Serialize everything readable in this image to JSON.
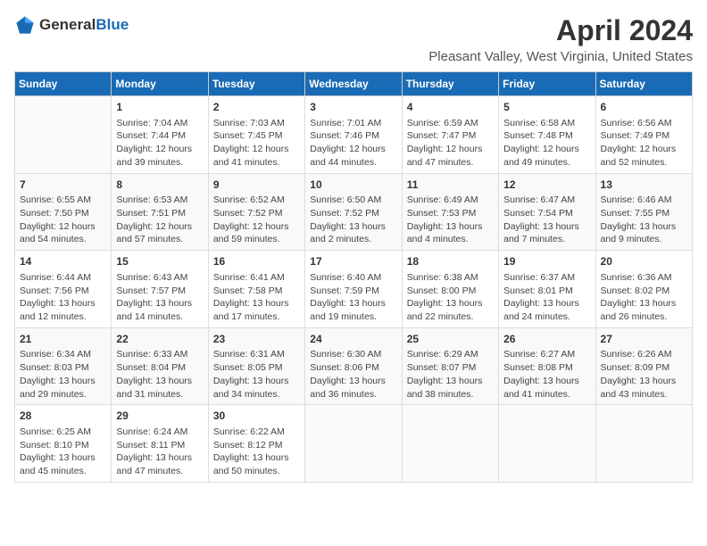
{
  "logo": {
    "general": "General",
    "blue": "Blue"
  },
  "title": "April 2024",
  "subtitle": "Pleasant Valley, West Virginia, United States",
  "days_of_week": [
    "Sunday",
    "Monday",
    "Tuesday",
    "Wednesday",
    "Thursday",
    "Friday",
    "Saturday"
  ],
  "weeks": [
    [
      {
        "day": "",
        "content": ""
      },
      {
        "day": "1",
        "content": "Sunrise: 7:04 AM\nSunset: 7:44 PM\nDaylight: 12 hours\nand 39 minutes."
      },
      {
        "day": "2",
        "content": "Sunrise: 7:03 AM\nSunset: 7:45 PM\nDaylight: 12 hours\nand 41 minutes."
      },
      {
        "day": "3",
        "content": "Sunrise: 7:01 AM\nSunset: 7:46 PM\nDaylight: 12 hours\nand 44 minutes."
      },
      {
        "day": "4",
        "content": "Sunrise: 6:59 AM\nSunset: 7:47 PM\nDaylight: 12 hours\nand 47 minutes."
      },
      {
        "day": "5",
        "content": "Sunrise: 6:58 AM\nSunset: 7:48 PM\nDaylight: 12 hours\nand 49 minutes."
      },
      {
        "day": "6",
        "content": "Sunrise: 6:56 AM\nSunset: 7:49 PM\nDaylight: 12 hours\nand 52 minutes."
      }
    ],
    [
      {
        "day": "7",
        "content": "Sunrise: 6:55 AM\nSunset: 7:50 PM\nDaylight: 12 hours\nand 54 minutes."
      },
      {
        "day": "8",
        "content": "Sunrise: 6:53 AM\nSunset: 7:51 PM\nDaylight: 12 hours\nand 57 minutes."
      },
      {
        "day": "9",
        "content": "Sunrise: 6:52 AM\nSunset: 7:52 PM\nDaylight: 12 hours\nand 59 minutes."
      },
      {
        "day": "10",
        "content": "Sunrise: 6:50 AM\nSunset: 7:52 PM\nDaylight: 13 hours\nand 2 minutes."
      },
      {
        "day": "11",
        "content": "Sunrise: 6:49 AM\nSunset: 7:53 PM\nDaylight: 13 hours\nand 4 minutes."
      },
      {
        "day": "12",
        "content": "Sunrise: 6:47 AM\nSunset: 7:54 PM\nDaylight: 13 hours\nand 7 minutes."
      },
      {
        "day": "13",
        "content": "Sunrise: 6:46 AM\nSunset: 7:55 PM\nDaylight: 13 hours\nand 9 minutes."
      }
    ],
    [
      {
        "day": "14",
        "content": "Sunrise: 6:44 AM\nSunset: 7:56 PM\nDaylight: 13 hours\nand 12 minutes."
      },
      {
        "day": "15",
        "content": "Sunrise: 6:43 AM\nSunset: 7:57 PM\nDaylight: 13 hours\nand 14 minutes."
      },
      {
        "day": "16",
        "content": "Sunrise: 6:41 AM\nSunset: 7:58 PM\nDaylight: 13 hours\nand 17 minutes."
      },
      {
        "day": "17",
        "content": "Sunrise: 6:40 AM\nSunset: 7:59 PM\nDaylight: 13 hours\nand 19 minutes."
      },
      {
        "day": "18",
        "content": "Sunrise: 6:38 AM\nSunset: 8:00 PM\nDaylight: 13 hours\nand 22 minutes."
      },
      {
        "day": "19",
        "content": "Sunrise: 6:37 AM\nSunset: 8:01 PM\nDaylight: 13 hours\nand 24 minutes."
      },
      {
        "day": "20",
        "content": "Sunrise: 6:36 AM\nSunset: 8:02 PM\nDaylight: 13 hours\nand 26 minutes."
      }
    ],
    [
      {
        "day": "21",
        "content": "Sunrise: 6:34 AM\nSunset: 8:03 PM\nDaylight: 13 hours\nand 29 minutes."
      },
      {
        "day": "22",
        "content": "Sunrise: 6:33 AM\nSunset: 8:04 PM\nDaylight: 13 hours\nand 31 minutes."
      },
      {
        "day": "23",
        "content": "Sunrise: 6:31 AM\nSunset: 8:05 PM\nDaylight: 13 hours\nand 34 minutes."
      },
      {
        "day": "24",
        "content": "Sunrise: 6:30 AM\nSunset: 8:06 PM\nDaylight: 13 hours\nand 36 minutes."
      },
      {
        "day": "25",
        "content": "Sunrise: 6:29 AM\nSunset: 8:07 PM\nDaylight: 13 hours\nand 38 minutes."
      },
      {
        "day": "26",
        "content": "Sunrise: 6:27 AM\nSunset: 8:08 PM\nDaylight: 13 hours\nand 41 minutes."
      },
      {
        "day": "27",
        "content": "Sunrise: 6:26 AM\nSunset: 8:09 PM\nDaylight: 13 hours\nand 43 minutes."
      }
    ],
    [
      {
        "day": "28",
        "content": "Sunrise: 6:25 AM\nSunset: 8:10 PM\nDaylight: 13 hours\nand 45 minutes."
      },
      {
        "day": "29",
        "content": "Sunrise: 6:24 AM\nSunset: 8:11 PM\nDaylight: 13 hours\nand 47 minutes."
      },
      {
        "day": "30",
        "content": "Sunrise: 6:22 AM\nSunset: 8:12 PM\nDaylight: 13 hours\nand 50 minutes."
      },
      {
        "day": "",
        "content": ""
      },
      {
        "day": "",
        "content": ""
      },
      {
        "day": "",
        "content": ""
      },
      {
        "day": "",
        "content": ""
      }
    ]
  ]
}
